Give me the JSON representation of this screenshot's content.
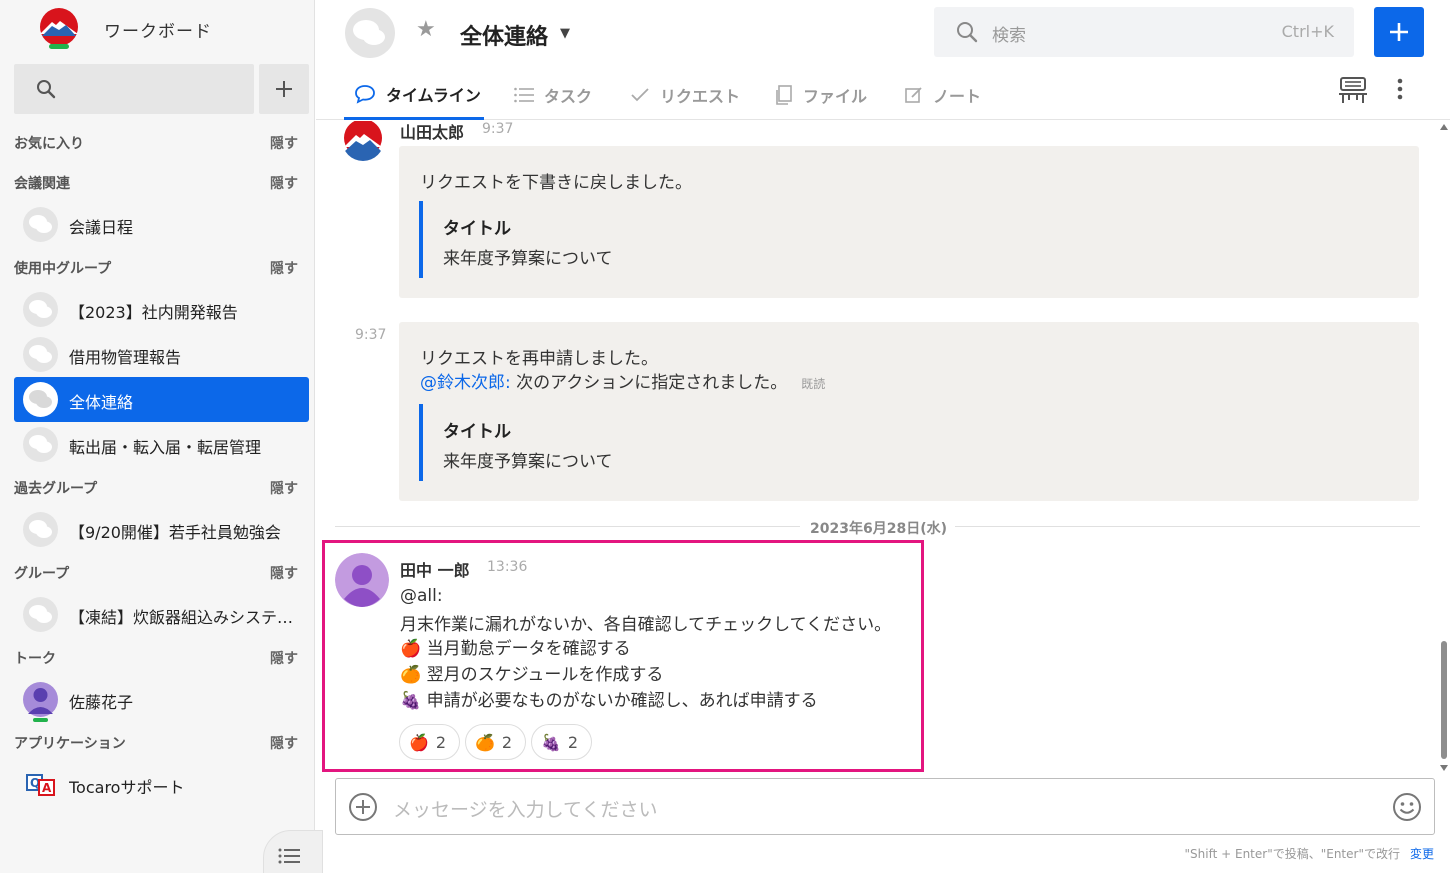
{
  "workspace": {
    "name": "ワークボード"
  },
  "sidebar": {
    "sections": [
      {
        "title": "お気に入り",
        "hide": "隠す",
        "items": []
      },
      {
        "title": "会議関連",
        "hide": "隠す",
        "items": [
          {
            "label": "会議日程",
            "active": false
          }
        ]
      },
      {
        "title": "使用中グループ",
        "hide": "隠す",
        "items": [
          {
            "label": "【2023】社内開発報告",
            "active": false
          },
          {
            "label": "借用物管理報告",
            "active": false
          },
          {
            "label": "全体連絡",
            "active": true
          },
          {
            "label": "転出届・転入届・転居管理",
            "active": false
          }
        ]
      },
      {
        "title": "過去グループ",
        "hide": "隠す",
        "items": [
          {
            "label": "【9/20開催】若手社員勉強会",
            "active": false
          }
        ]
      },
      {
        "title": "グループ",
        "hide": "隠す",
        "items": [
          {
            "label": "【凍結】炊飯器組込みシステ…",
            "active": false
          }
        ]
      },
      {
        "title": "トーク",
        "hide": "隠す",
        "items": [
          {
            "label": "佐藤花子",
            "active": false
          }
        ]
      },
      {
        "title": "アプリケーション",
        "hide": "隠す",
        "items": [
          {
            "label": "Tocaroサポート",
            "active": false
          }
        ]
      }
    ]
  },
  "header": {
    "room_title": "全体連絡",
    "search_placeholder": "検索",
    "search_shortcut": "Ctrl+K",
    "tabs": [
      {
        "label": "タイムライン",
        "icon": "chat-icon",
        "active": true
      },
      {
        "label": "タスク",
        "icon": "list-icon",
        "active": false
      },
      {
        "label": "リクエスト",
        "icon": "check-icon",
        "active": false
      },
      {
        "label": "ファイル",
        "icon": "file-icon",
        "active": false
      },
      {
        "label": "ノート",
        "icon": "note-icon",
        "active": false
      }
    ]
  },
  "timeline": {
    "msg1": {
      "sender": "山田太郎",
      "time": "9:37",
      "text": "リクエストを下書きに戻しました。",
      "quote_title": "タイトル",
      "quote_body": "来年度予算案について"
    },
    "msg2": {
      "time": "9:37",
      "text": "リクエストを再申請しました。",
      "mention": "@鈴木次郎:",
      "mention_text": " 次のアクションに指定されました。",
      "read": "既読",
      "quote_title": "タイトル",
      "quote_body": "来年度予算案について"
    },
    "date_separator": "2023年6月28日(水)",
    "msg3": {
      "sender": "田中 一郎",
      "time": "13:36",
      "mention": "@all:",
      "line1": "月末作業に漏れがないか、各自確認してチェックしてください。",
      "items": [
        {
          "emoji": "🍎",
          "text": "当月勤怠データを確認する"
        },
        {
          "emoji": "🍊",
          "text": "翌月のスケジュールを作成する"
        },
        {
          "emoji": "🍇",
          "text": "申請が必要なものがないか確認し、あれば申請する"
        }
      ],
      "reactions": [
        {
          "emoji": "🍎",
          "count": "2"
        },
        {
          "emoji": "🍊",
          "count": "2"
        },
        {
          "emoji": "🍇",
          "count": "2"
        }
      ]
    }
  },
  "composer": {
    "placeholder": "メッセージを入力してください",
    "hint": "\"Shift + Enter\"で投稿、\"Enter\"で改行",
    "change": "変更"
  },
  "colors": {
    "accent": "#0c68e9",
    "highlight": "#e3157f"
  }
}
